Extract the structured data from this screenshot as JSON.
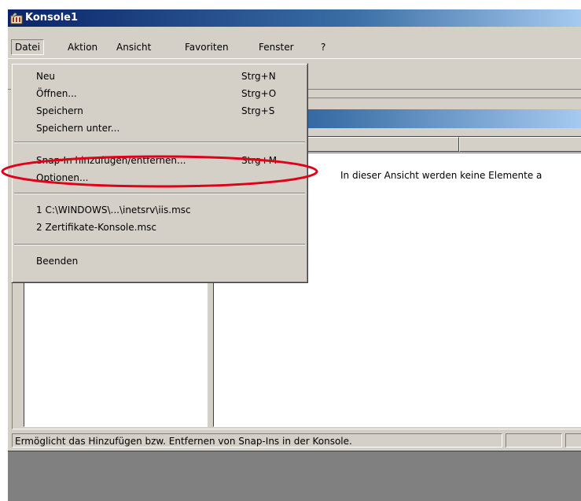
{
  "window": {
    "title": "Konsole1"
  },
  "menubar": {
    "items": [
      "Datei",
      "Aktion",
      "Ansicht",
      "Favoriten",
      "Fenster",
      "?"
    ]
  },
  "file_menu": {
    "items": [
      {
        "label": "Neu",
        "shortcut": "Strg+N"
      },
      {
        "label": "Öffnen...",
        "shortcut": "Strg+O"
      },
      {
        "label": "Speichern",
        "shortcut": "Strg+S"
      },
      {
        "label": "Speichern unter...",
        "shortcut": ""
      },
      {
        "label": "Snap-In hinzufügen/entfernen...",
        "shortcut": "Strg+M"
      },
      {
        "label": "Optionen...",
        "shortcut": ""
      },
      {
        "label": "1 C:\\WINDOWS\\...\\inetsrv\\iis.msc",
        "shortcut": ""
      },
      {
        "label": "2 Zertifikate-Konsole.msc",
        "shortcut": ""
      },
      {
        "label": "Beenden",
        "shortcut": ""
      }
    ]
  },
  "list_pane": {
    "empty_text": "In dieser Ansicht werden keine Elemente a"
  },
  "statusbar": {
    "text": "Ermöglicht das Hinzufügen bzw. Entfernen von Snap-Ins in der Konsole."
  },
  "colors": {
    "title_gradient_start": "#0a246a",
    "highlight_ellipse": "#e0001a",
    "face": "#d4d0c8"
  },
  "icons": {
    "app": "mmc-console-icon"
  }
}
